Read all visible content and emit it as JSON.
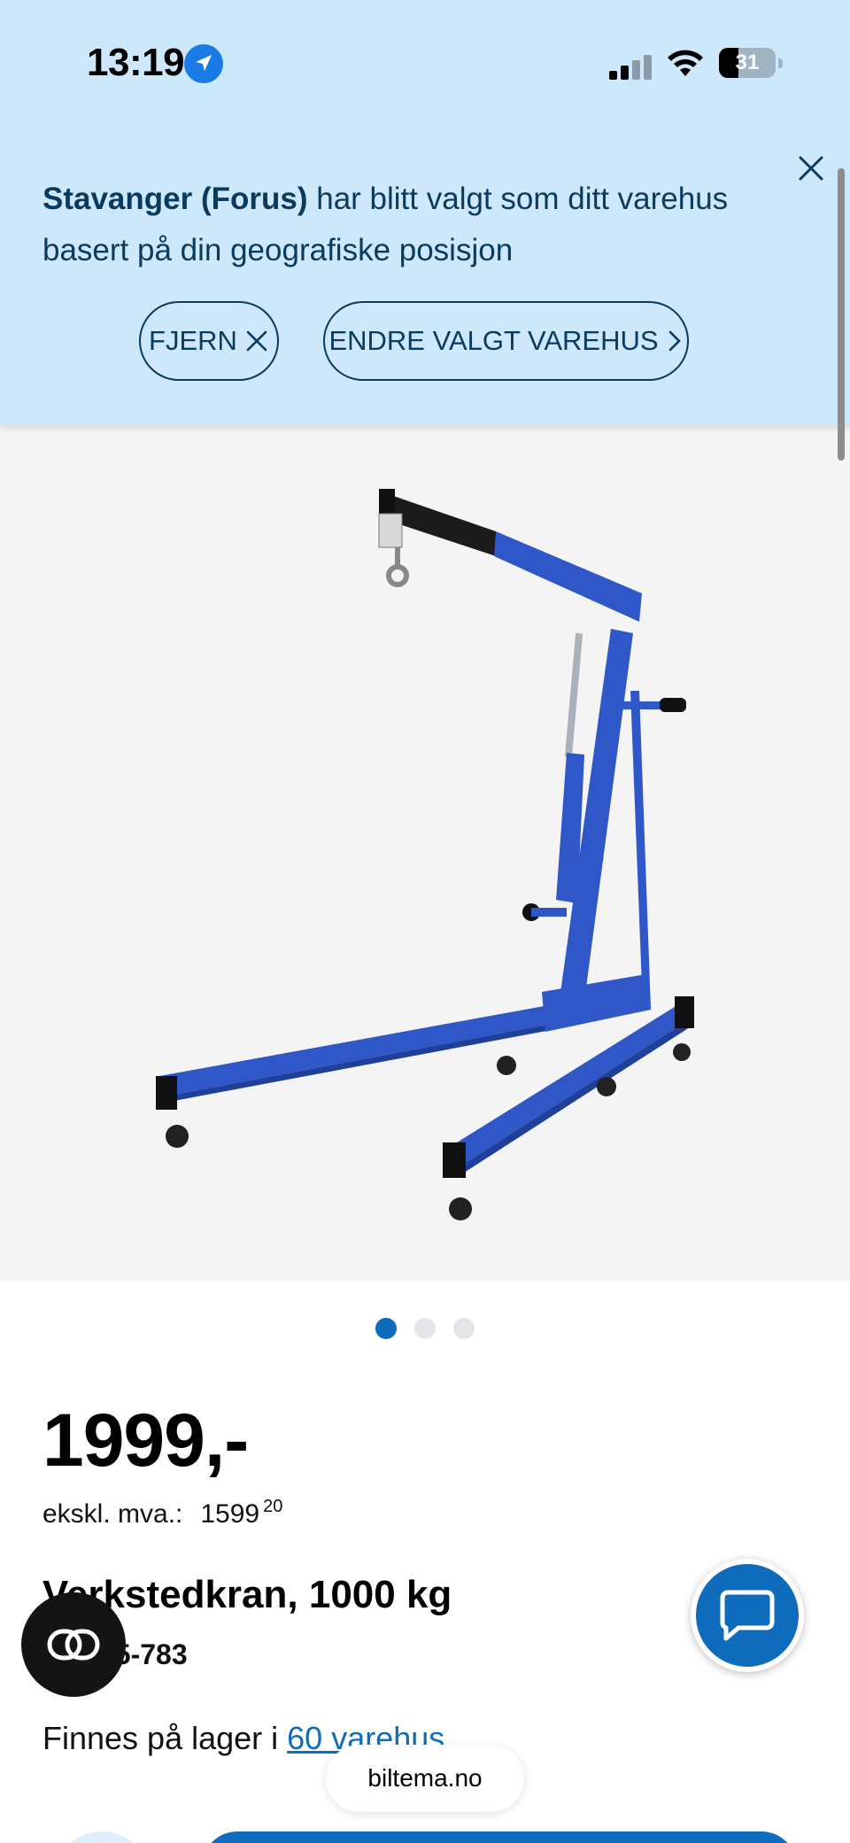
{
  "status_bar": {
    "time": "13:19",
    "battery": "31",
    "icons": [
      "location-arrow-icon",
      "cellular-signal-icon",
      "wifi-icon",
      "battery-icon"
    ]
  },
  "banner": {
    "store_name": "Stavanger (Forus)",
    "message_rest": " har blitt valgt som ditt varehus basert på din geografiske posisjon",
    "remove_label": "FJERN",
    "change_label": "ENDRE VALGT VAREHUS",
    "colors": {
      "background": "#cce8fa",
      "text": "#0a3a5e"
    }
  },
  "gallery": {
    "image_subject": "blue-workshop-crane",
    "dot_count": 3,
    "active_index": 0
  },
  "product": {
    "price": "1999,-",
    "ex_vat_label": "ekskl. mva.:",
    "ex_vat_value": "1599",
    "ex_vat_decimals": "20",
    "title": "Verkstedkran, 1000 kg",
    "article_number": "Art. 15-783",
    "stock_prefix": "Finnes på lager i ",
    "stock_link": "60 varehus"
  },
  "browser": {
    "url": "biltema.no"
  },
  "colors": {
    "brand_blue": "#0f6cbd",
    "crane_blue": "#2f57c8"
  }
}
